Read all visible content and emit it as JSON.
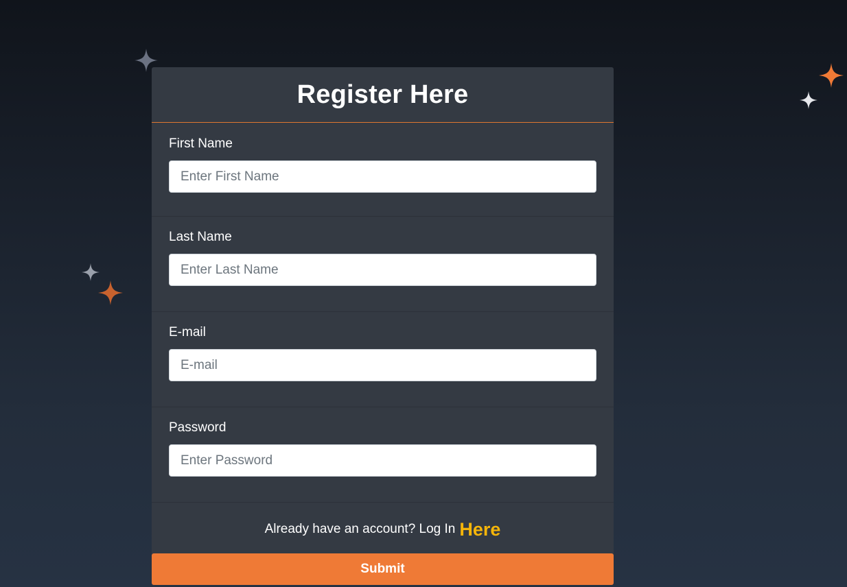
{
  "form": {
    "title": "Register Here",
    "fields": [
      {
        "label": "First Name",
        "placeholder": "Enter First Name",
        "value": "",
        "type": "text"
      },
      {
        "label": "Last Name",
        "placeholder": "Enter Last Name",
        "value": "",
        "type": "text"
      },
      {
        "label": "E-mail",
        "placeholder": "E-mail",
        "value": "",
        "type": "email"
      },
      {
        "label": "Password",
        "placeholder": "Enter Password",
        "value": "",
        "type": "password"
      }
    ],
    "login_prompt": "Already have an account? Log In",
    "login_link": "Here",
    "submit_label": "Submit"
  },
  "decorations": {
    "icons": [
      "sparkle-icon"
    ],
    "colors": {
      "white_star": "#e6e8ec",
      "grey_star": "#6b7282",
      "orange_star": "#ef7a36"
    }
  },
  "colors": {
    "accent": "#ef7a36",
    "link": "#f5b50a",
    "card": "#343a43",
    "background_top": "#10141b",
    "background_bottom": "#263243"
  }
}
